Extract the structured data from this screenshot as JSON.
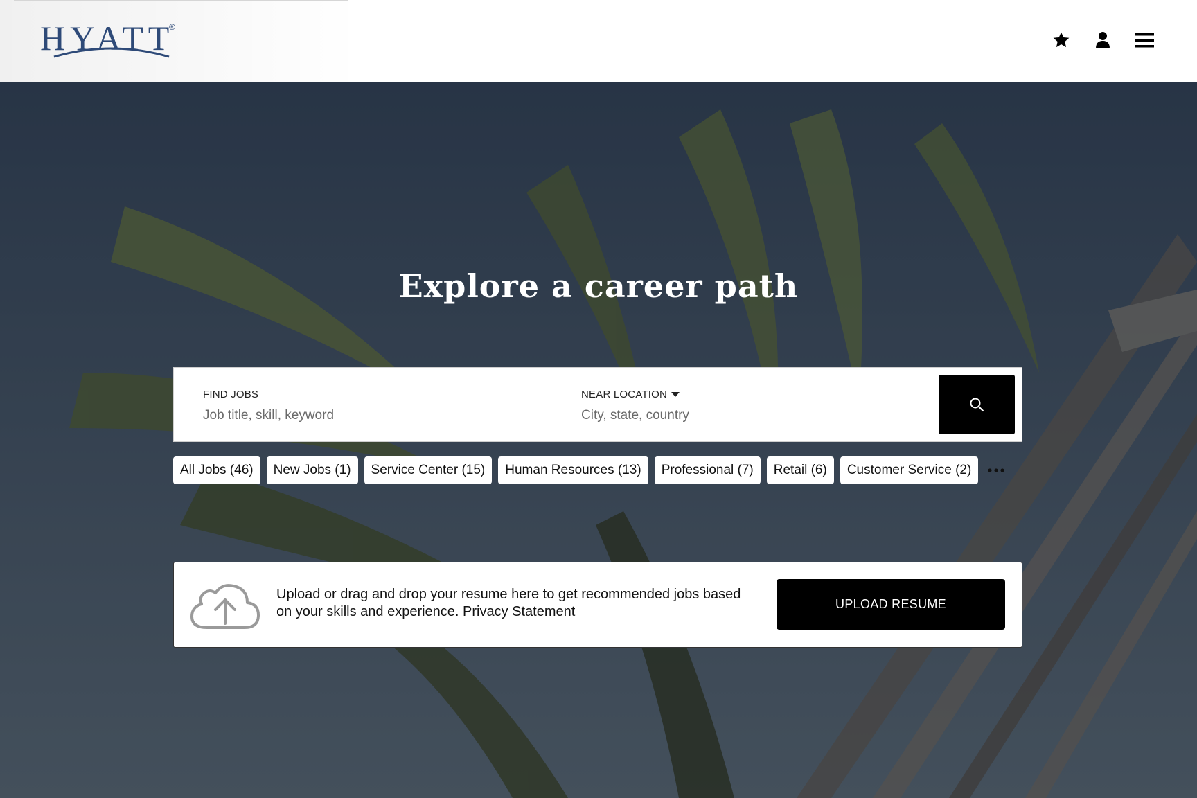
{
  "header": {
    "logo_text": "HYATT",
    "logo_reg": "®",
    "icons": [
      "star-icon",
      "user-icon",
      "menu-icon"
    ]
  },
  "hero": {
    "title": "Explore a career path"
  },
  "search": {
    "find_label": "FIND JOBS",
    "find_placeholder": "Job title, skill, keyword",
    "location_label": "NEAR LOCATION",
    "location_placeholder": "City, state, country",
    "search_icon": "search-icon"
  },
  "chips": [
    "All Jobs (46)",
    "New Jobs (1)",
    "Service Center (15)",
    "Human Resources (13)",
    "Professional (7)",
    "Retail (6)",
    "Customer Service (2)"
  ],
  "upload": {
    "text_line1": "Upload or drag and drop your resume here to get recommended jobs based",
    "text_line2": "on your skills and experience. Privacy Statement",
    "button_label": "UPLOAD RESUME"
  },
  "colors": {
    "brand_blue": "#2e4a78",
    "black": "#000000",
    "white": "#ffffff"
  }
}
